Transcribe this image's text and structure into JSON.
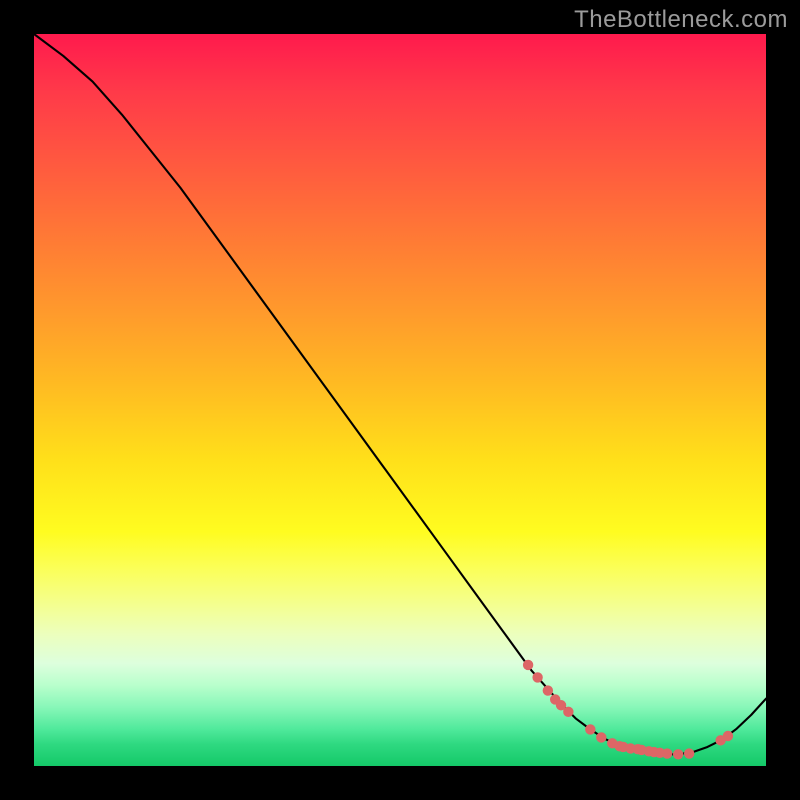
{
  "watermark": "TheBottleneck.com",
  "chart_data": {
    "type": "line",
    "title": "",
    "xlabel": "",
    "ylabel": "",
    "xlim": [
      0,
      100
    ],
    "ylim": [
      0,
      100
    ],
    "series": [
      {
        "name": "bottleneck-curve",
        "x": [
          0,
          4,
          8,
          12,
          16,
          20,
          24,
          28,
          32,
          36,
          40,
          44,
          48,
          52,
          56,
          60,
          64,
          68,
          72,
          74,
          76,
          78,
          80,
          82,
          84,
          86,
          88,
          90,
          92,
          94,
          96,
          98,
          100
        ],
        "y": [
          100,
          97,
          93.5,
          89,
          84,
          79,
          73.5,
          68,
          62.5,
          57,
          51.5,
          46,
          40.5,
          35,
          29.5,
          24,
          18.5,
          13,
          8.5,
          6.5,
          5,
          3.7,
          2.8,
          2.2,
          1.8,
          1.6,
          1.6,
          1.9,
          2.6,
          3.6,
          5.1,
          7.0,
          9.2
        ]
      }
    ],
    "markers": {
      "name": "highlight-points",
      "x": [
        67.5,
        68.8,
        70.2,
        71.2,
        72.0,
        73.0,
        76.0,
        77.5,
        79.0,
        80.0,
        80.5,
        81.5,
        82.5,
        83.0,
        84.0,
        84.7,
        85.5,
        86.5,
        88.0,
        89.5,
        93.8,
        94.8
      ],
      "y": [
        13.8,
        12.1,
        10.3,
        9.1,
        8.3,
        7.4,
        5.0,
        3.9,
        3.1,
        2.7,
        2.6,
        2.4,
        2.3,
        2.2,
        2.0,
        1.9,
        1.8,
        1.7,
        1.6,
        1.7,
        3.5,
        4.1
      ]
    },
    "background": "vertical gradient red (top) through orange, yellow, to green (bottom)"
  }
}
